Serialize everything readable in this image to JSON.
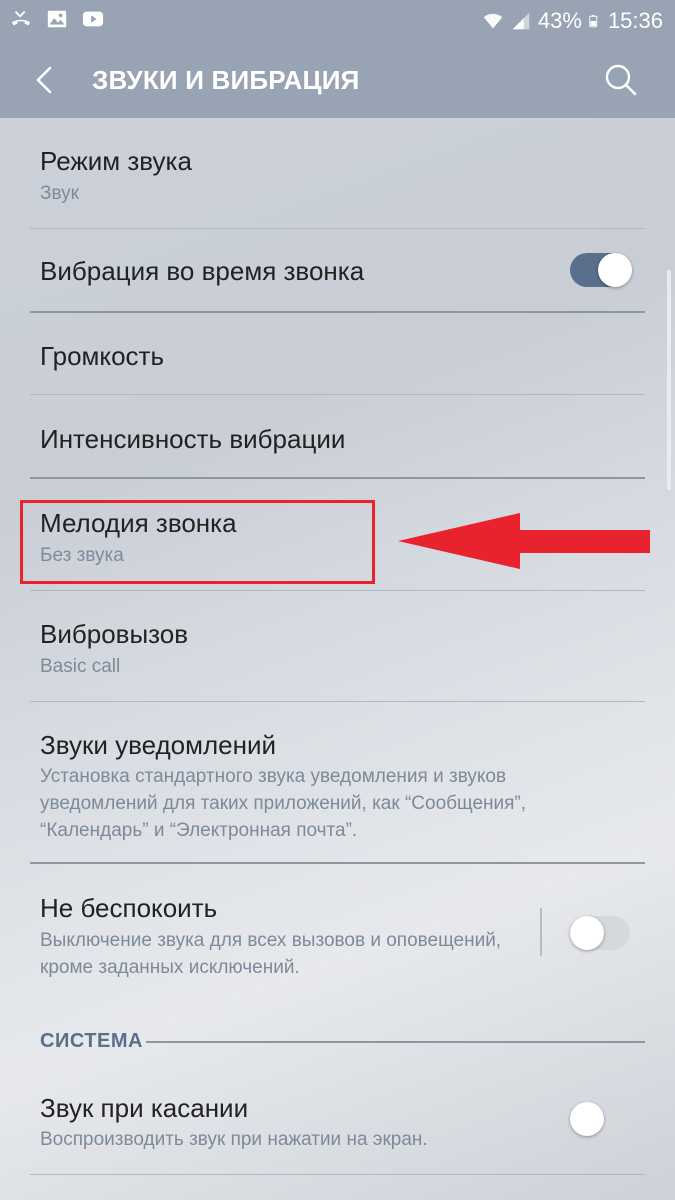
{
  "status_bar": {
    "left_icons": [
      "missed-call-icon",
      "image-icon",
      "youtube-icon"
    ],
    "battery_percent": "43%",
    "time": "15:36"
  },
  "header": {
    "title": "ЗВУКИ И ВИБРАЦИЯ"
  },
  "settings": {
    "sound_mode": {
      "title": "Режим звука",
      "subtitle": "Звук"
    },
    "vibrate_while_ringing": {
      "title": "Вибрация во время звонка",
      "enabled": true
    },
    "volume": {
      "title": "Громкость"
    },
    "vibration_intensity": {
      "title": "Интенсивность вибрации"
    },
    "ringtone": {
      "title": "Мелодия звонка",
      "subtitle": "Без звука"
    },
    "vibration_pattern": {
      "title": "Вибровызов",
      "subtitle": "Basic call"
    },
    "notification_sounds": {
      "title": "Звуки уведомлений",
      "subtitle": "Установка стандартного звука уведомления и звуков уведомлений для таких приложений, как “Сообщения”, “Календарь” и “Электронная почта”."
    },
    "do_not_disturb": {
      "title": "Не беспокоить",
      "subtitle": "Выключение звука для всех вызовов и оповещений, кроме заданных исключений.",
      "enabled": false
    }
  },
  "system_section": {
    "label": "СИСТЕМА",
    "touch_sounds": {
      "title": "Звук при касании",
      "subtitle": "Воспроизводить звук при нажатии на экран.",
      "enabled": false
    }
  },
  "colors": {
    "header_bg": "#98a3b3",
    "accent": "#5a6f8c",
    "annotation_red": "#e8232d"
  }
}
